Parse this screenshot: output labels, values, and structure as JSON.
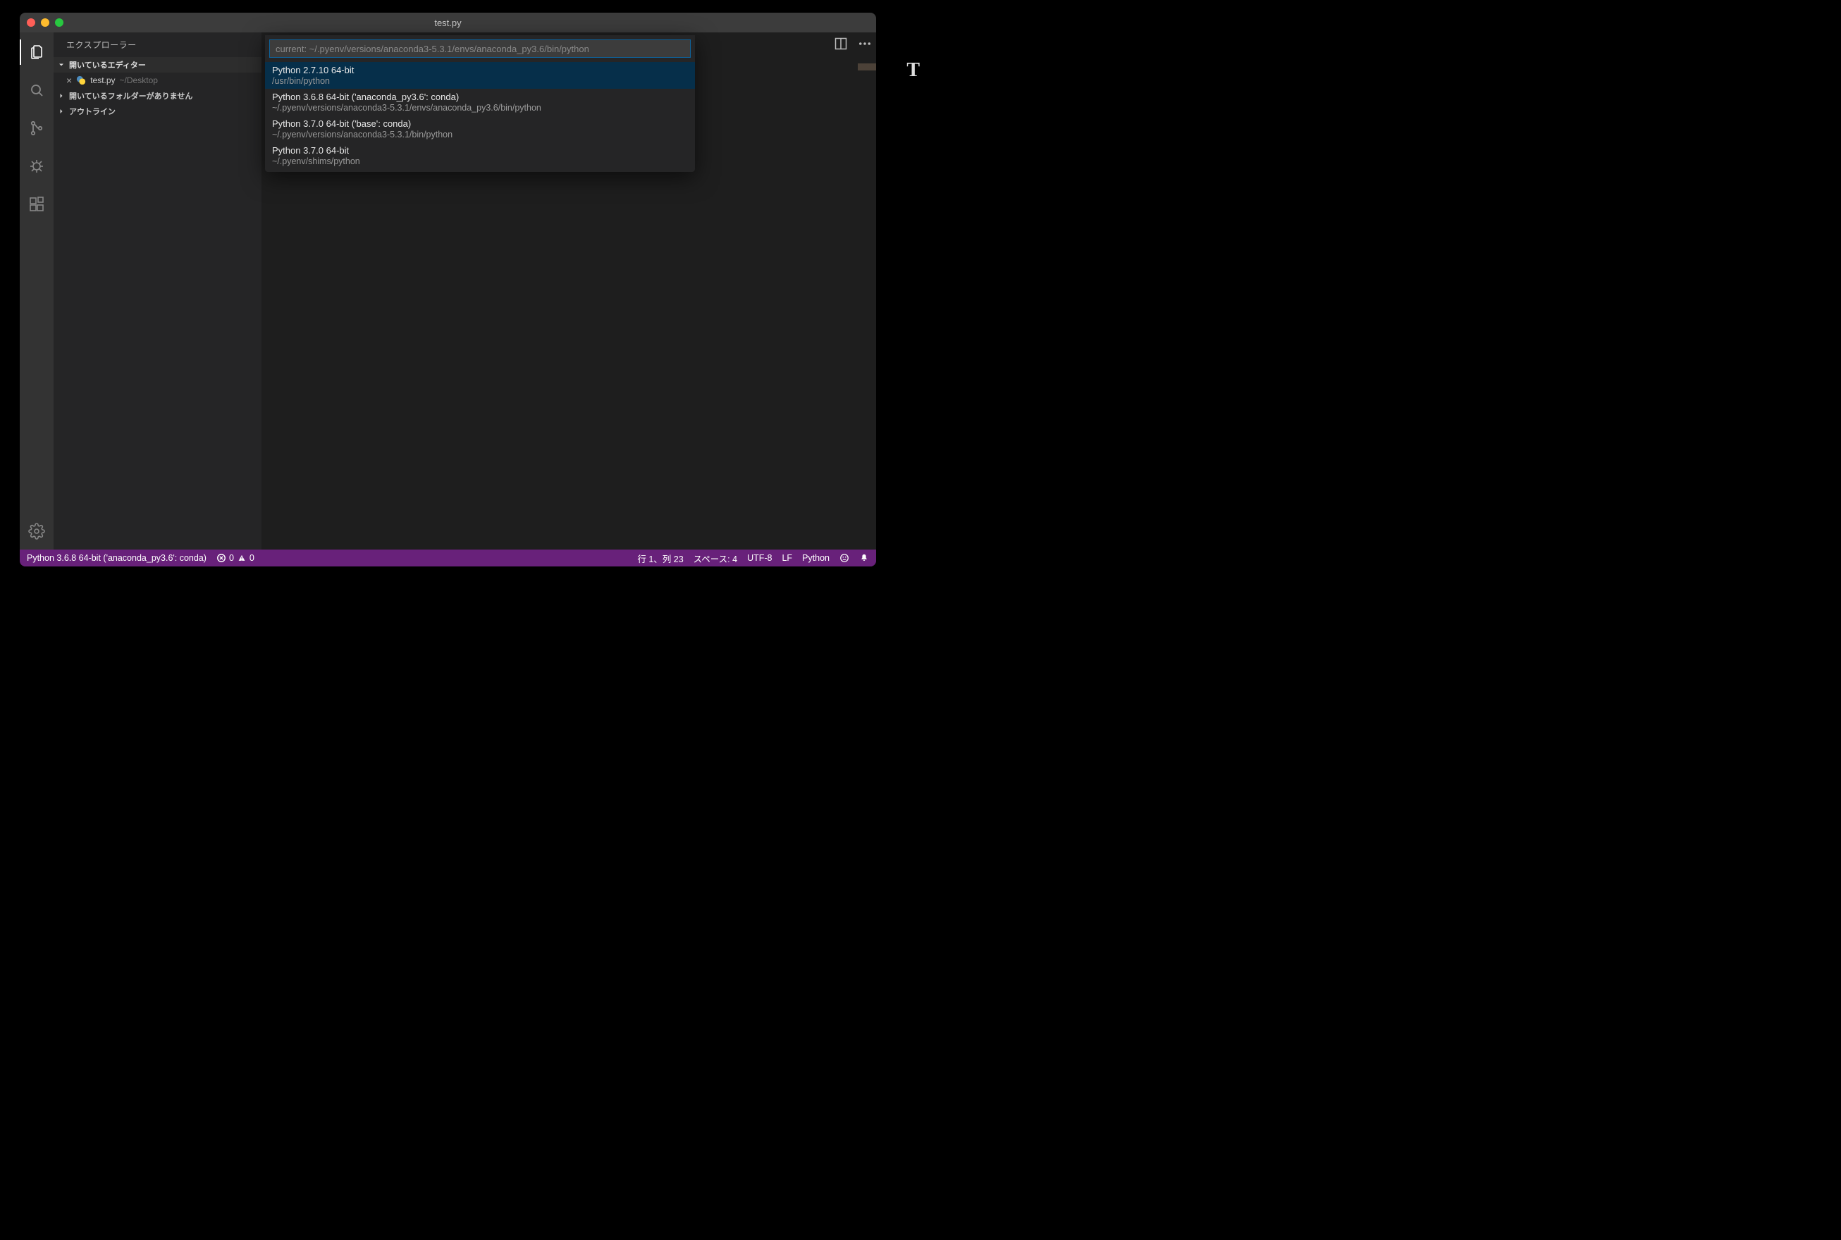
{
  "titlebar": {
    "title": "test.py"
  },
  "activitybar": {
    "items": [
      {
        "name": "files-icon",
        "active": true
      },
      {
        "name": "search-icon",
        "active": false
      },
      {
        "name": "source-control-icon",
        "active": false
      },
      {
        "name": "debug-icon",
        "active": false
      },
      {
        "name": "extensions-icon",
        "active": false
      }
    ]
  },
  "sidebar": {
    "title": "エクスプローラー",
    "open_editors": {
      "label": "開いているエディター",
      "items": [
        {
          "filename": "test.py",
          "path": "~/Desktop"
        }
      ]
    },
    "no_folder_msg": "開いているフォルダーがありません",
    "outline_label": "アウトライン"
  },
  "quickpick": {
    "placeholder": "current: ~/.pyenv/versions/anaconda3-5.3.1/envs/anaconda_py3.6/bin/python",
    "items": [
      {
        "title": "Python 2.7.10 64-bit",
        "detail": "/usr/bin/python",
        "selected": true
      },
      {
        "title": "Python 3.6.8 64-bit ('anaconda_py3.6': conda)",
        "detail": "~/.pyenv/versions/anaconda3-5.3.1/envs/anaconda_py3.6/bin/python",
        "selected": false
      },
      {
        "title": "Python 3.7.0 64-bit ('base': conda)",
        "detail": "~/.pyenv/versions/anaconda3-5.3.1/bin/python",
        "selected": false
      },
      {
        "title": "Python 3.7.0 64-bit",
        "detail": "~/.pyenv/shims/python",
        "selected": false
      }
    ]
  },
  "statusbar": {
    "interpreter": "Python 3.6.8 64-bit ('anaconda_py3.6': conda)",
    "errors": "0",
    "warnings": "0",
    "cursor": "行 1、列 23",
    "spaces": "スペース: 4",
    "encoding": "UTF-8",
    "eol": "LF",
    "language": "Python"
  },
  "decor": {
    "big_t": "T"
  }
}
